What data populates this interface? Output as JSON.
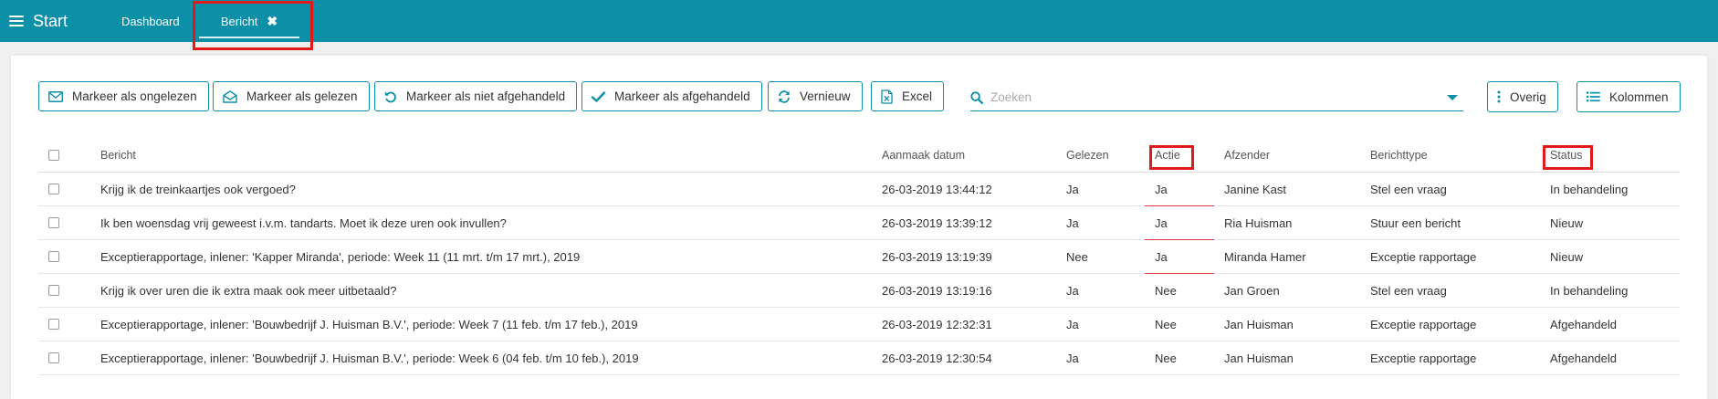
{
  "topbar": {
    "start_label": "Start",
    "tabs": [
      {
        "label": "Dashboard",
        "active": false
      },
      {
        "label": "Bericht",
        "active": true
      }
    ],
    "close_glyph": "✖"
  },
  "toolbar": {
    "buttons": [
      {
        "label": "Markeer als ongelezen",
        "icon": "envelope-icon"
      },
      {
        "label": "Markeer als gelezen",
        "icon": "envelope-open-icon"
      },
      {
        "label": "Markeer als niet afgehandeld",
        "icon": "undo-icon"
      },
      {
        "label": "Markeer als afgehandeld",
        "icon": "check-icon"
      },
      {
        "label": "Vernieuw",
        "icon": "refresh-icon"
      },
      {
        "label": "Excel",
        "icon": "excel-file-icon"
      }
    ],
    "search_placeholder": "Zoeken",
    "search_value": "",
    "right_buttons": [
      {
        "label": "Overig",
        "icon": "vertical-dots-icon"
      },
      {
        "label": "Kolommen",
        "icon": "list-icon"
      }
    ]
  },
  "table": {
    "columns": [
      "Bericht",
      "Aanmaak datum",
      "Gelezen",
      "Actie",
      "Afzender",
      "Berichttype",
      "Status"
    ],
    "rows": [
      {
        "bericht": "Krijg ik de treinkaartjes ook vergoed?",
        "datum": "26-03-2019 13:44:12",
        "gelezen": "Ja",
        "actie": "Ja",
        "afzender": "Janine Kast",
        "type": "Stel een vraag",
        "status": "In behandeling"
      },
      {
        "bericht": "Ik ben woensdag vrij geweest i.v.m. tandarts. Moet ik deze uren ook invullen?",
        "datum": "26-03-2019 13:39:12",
        "gelezen": "Ja",
        "actie": "Ja",
        "afzender": "Ria Huisman",
        "type": "Stuur een bericht",
        "status": "Nieuw"
      },
      {
        "bericht": "Exceptierapportage, inlener: 'Kapper Miranda', periode: Week 11 (11 mrt. t/m 17 mrt.), 2019",
        "datum": "26-03-2019 13:19:39",
        "gelezen": "Nee",
        "actie": "Ja",
        "afzender": "Miranda Hamer",
        "type": "Exceptie rapportage",
        "status": "Nieuw"
      },
      {
        "bericht": "Krijg ik over uren die ik extra maak ook meer uitbetaald?",
        "datum": "26-03-2019 13:19:16",
        "gelezen": "Ja",
        "actie": "Nee",
        "afzender": "Jan Groen",
        "type": "Stel een vraag",
        "status": "In behandeling"
      },
      {
        "bericht": "Exceptierapportage, inlener: 'Bouwbedrijf J. Huisman B.V.', periode: Week 7 (11 feb. t/m 17 feb.), 2019",
        "datum": "26-03-2019 12:32:31",
        "gelezen": "Ja",
        "actie": "Nee",
        "afzender": "Jan Huisman",
        "type": "Exceptie rapportage",
        "status": "Afgehandeld"
      },
      {
        "bericht": "Exceptierapportage, inlener: 'Bouwbedrijf J. Huisman B.V.', periode: Week 6 (04 feb. t/m 10 feb.), 2019",
        "datum": "26-03-2019 12:30:54",
        "gelezen": "Ja",
        "actie": "Nee",
        "afzender": "Jan Huisman",
        "type": "Exceptie rapportage",
        "status": "Afgehandeld"
      }
    ]
  },
  "colors": {
    "accent": "#0b90a8",
    "highlight": "#e01a1a",
    "actie_marker": "#e03a3a"
  }
}
